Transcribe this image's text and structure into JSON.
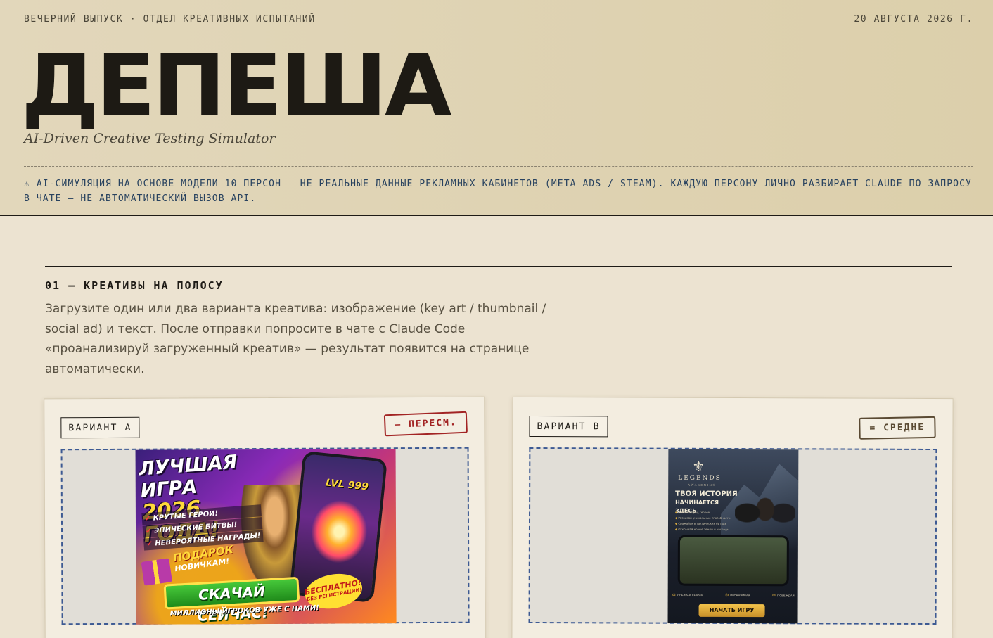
{
  "header": {
    "edition": "ВЕЧЕРНИЙ ВЫПУСК · ОТДЕЛ КРЕАТИВНЫХ ИСПЫТАНИЙ",
    "date": "20 АВГУСТА 2026 Г.",
    "logo": "ДЕПЕША",
    "subtitle": "AI-Driven Creative Testing Simulator",
    "disclaimer": "⚠ AI-СИМУЛЯЦИЯ НА ОСНОВЕ МОДЕЛИ 10 ПЕРСОН — НЕ РЕАЛЬНЫЕ ДАННЫЕ РЕКЛАМНЫХ КАБИНЕТОВ (META ADS / STEAM). КАЖДУЮ ПЕРСОНУ ЛИЧНО РАЗБИРАЕТ CLAUDE ПО ЗАПРОСУ В ЧАТЕ — НЕ АВТОМАТИЧЕСКИЙ ВЫЗОВ API."
  },
  "section": {
    "title": "01 — КРЕАТИВЫ НА ПОЛОСУ",
    "description": "Загрузите один или два варианта креатива: изображение (key art / thumbnail / social ad) и текст. После отправки попросите в чате с Claude Code «проанализируй загруженный креатив» — результат появится на странице автоматически."
  },
  "variants": [
    {
      "label": "ВАРИАНТ A",
      "stamp": "– ПЕРЕСМ.",
      "stamp_color": "#a22424",
      "creative": {
        "title_line1": "ЛУЧШАЯ ИГРА",
        "title_line2": "2026 ГОДА!",
        "features": [
          "КРУТЫЕ ГЕРОИ!",
          "ЭПИЧЕСКИЕ БИТВЫ!",
          "НЕВЕРОЯТНЫЕ НАГРАДЫ!"
        ],
        "level": "LVL 999",
        "gift_big": "ПОДАРОК",
        "gift_small": "НОВИЧКАМ!",
        "cta": "СКАЧАЙ СЕЙЧАС!",
        "free_big": "БЕСПЛАТНО!",
        "free_small": "БЕЗ РЕГИСТРАЦИИ!",
        "footer": "МИЛЛИОНЫ ИГРОКОВ УЖЕ С НАМИ!"
      }
    },
    {
      "label": "ВАРИАНТ B",
      "stamp": "= СРЕДНЕ",
      "stamp_color": "#5a4a33",
      "creative": {
        "logo": "LEGENDS",
        "logo_sub": "AWAKENING",
        "headline_line1": "ТВОЯ ИСТОРИЯ",
        "headline_line2": "НАЧИНАЕТСЯ ЗДЕСЬ",
        "list": [
          "Собери отряд героев",
          "Развивай уникальные способности",
          "Сражайся в тактических битвах",
          "Открывай новые земли и награды"
        ],
        "features": [
          "СОБИРАЙ ГЕРОЕВ",
          "ПРОКАЧИВАЙ",
          "ПОБЕЖДАЙ"
        ],
        "cta": "НАЧАТЬ ИГРУ"
      }
    }
  ],
  "colors": {
    "accent_red": "#a22424",
    "drop_border": "#3d5a93",
    "ink": "#1e1b16",
    "masthead_bg": "#ddd0ad"
  }
}
